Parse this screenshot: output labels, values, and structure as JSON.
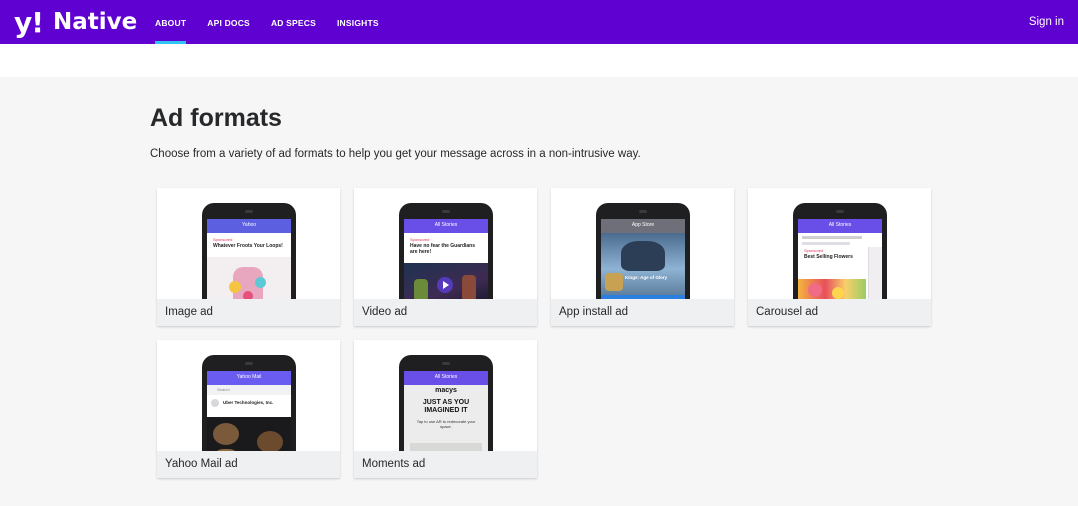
{
  "header": {
    "logo_mark": "y!",
    "logo_word": "Native",
    "nav": [
      "ABOUT",
      "API DOCS",
      "AD SPECS",
      "INSIGHTS"
    ],
    "active_nav": "ABOUT",
    "signin": "Sign in"
  },
  "page": {
    "title": "Ad formats",
    "subtitle": "Choose from a variety of ad formats to help you get your message across in a non-intrusive way."
  },
  "cards": [
    {
      "label": "Image ad",
      "mock": {
        "bar": "Yahoo",
        "sponsored": "Sponsored",
        "headline": "Whatever Froots Your Loops!"
      }
    },
    {
      "label": "Video ad",
      "mock": {
        "bar": "All Stories",
        "sponsored": "Sponsored",
        "headline": "Have no fear the Guardians are here!"
      }
    },
    {
      "label": "App install ad",
      "mock": {
        "bar": "App Store",
        "headline": "Kings: Age of Glory"
      }
    },
    {
      "label": "Carousel ad",
      "mock": {
        "bar": "All Stories",
        "sponsored": "Sponsored",
        "headline": "Best Selling Flowers"
      }
    },
    {
      "label": "Yahoo Mail ad",
      "mock": {
        "bar": "Yahoo Mail",
        "search": "Search",
        "headline": "Uber Technologies, Inc."
      }
    },
    {
      "label": "Moments ad",
      "mock": {
        "bar": "All Stories",
        "brand": "macys",
        "headline": "JUST AS YOU IMAGINED IT",
        "body": "Tap to use AR to redecorate your space."
      }
    }
  ],
  "colors": {
    "header_bg": "#5f01d1",
    "active_underline": "#31c3f6",
    "page_bg": "#f6f6f7",
    "caption_bg": "#eff0f1",
    "text": "#26282a"
  }
}
